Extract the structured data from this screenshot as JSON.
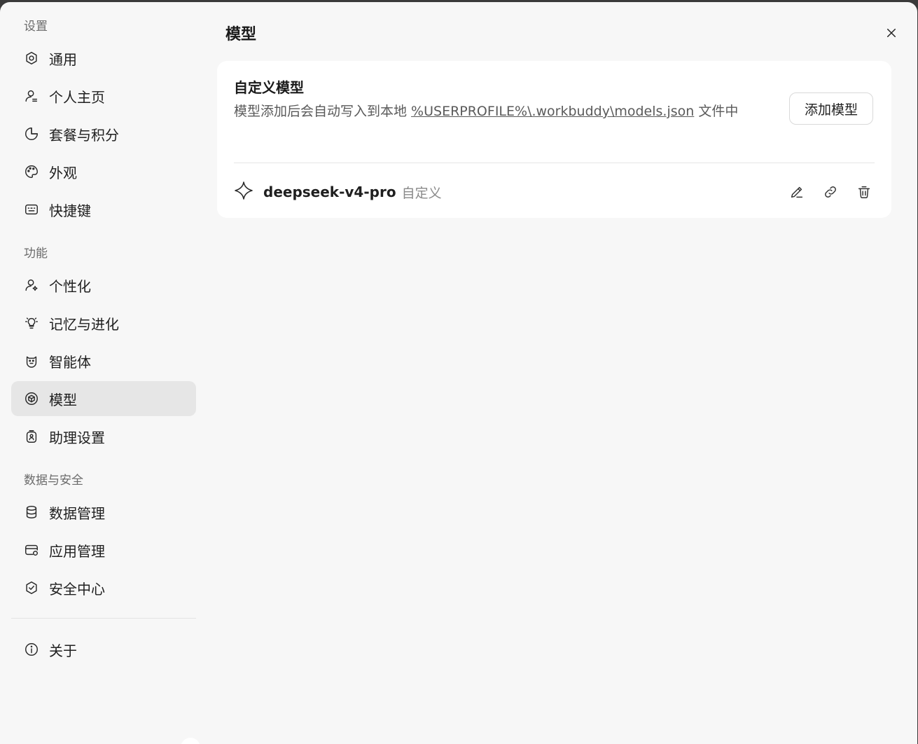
{
  "sidebar": {
    "sections": [
      {
        "title": "设置"
      },
      {
        "title": "功能"
      },
      {
        "title": "数据与安全"
      }
    ],
    "items": [
      {
        "label": "通用",
        "icon": "gear-icon"
      },
      {
        "label": "个人主页",
        "icon": "user-icon"
      },
      {
        "label": "套餐与积分",
        "icon": "pie-chart-icon"
      },
      {
        "label": "外观",
        "icon": "palette-icon"
      },
      {
        "label": "快捷键",
        "icon": "keyboard-icon"
      },
      {
        "label": "个性化",
        "icon": "user-sparkle-icon"
      },
      {
        "label": "记忆与进化",
        "icon": "lightbulb-icon"
      },
      {
        "label": "智能体",
        "icon": "agent-icon"
      },
      {
        "label": "模型",
        "icon": "model-cube-icon",
        "active": true
      },
      {
        "label": "助理设置",
        "icon": "assistant-icon"
      },
      {
        "label": "数据管理",
        "icon": "database-icon"
      },
      {
        "label": "应用管理",
        "icon": "app-card-icon"
      },
      {
        "label": "安全中心",
        "icon": "shield-check-icon"
      },
      {
        "label": "关于",
        "icon": "info-icon"
      }
    ]
  },
  "main": {
    "title": "模型",
    "card": {
      "title": "自定义模型",
      "desc_prefix": "模型添加后会自动写入到本地 ",
      "desc_path": "%USERPROFILE%\\.workbuddy\\models.json",
      "desc_suffix": " 文件中",
      "add_button": "添加模型",
      "models": [
        {
          "name": "deepseek-v4-pro",
          "tag": "自定义",
          "icon": "sparkle-icon"
        }
      ]
    }
  },
  "colors": {
    "background": "#f7f7f7",
    "card": "#ffffff",
    "active_item": "#e6e6e6"
  }
}
